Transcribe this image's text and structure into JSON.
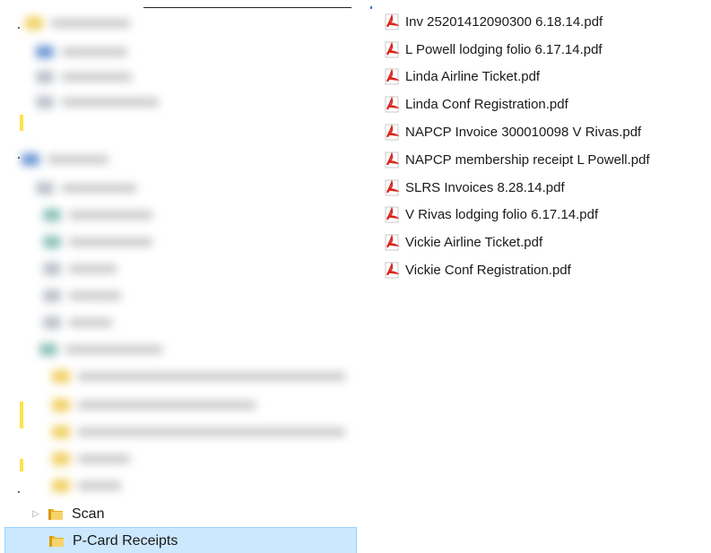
{
  "navigation_pane": {
    "tree": [
      {
        "label": "Scan",
        "expandable": true,
        "selected": false,
        "icon": "folder-icon"
      },
      {
        "label": "P-Card Receipts",
        "expandable": false,
        "selected": true,
        "icon": "folder-icon"
      }
    ]
  },
  "file_list": {
    "items": [
      {
        "name": "Inv 25201412090300 6.18.14.pdf",
        "icon": "pdf-icon"
      },
      {
        "name": "L Powell lodging folio 6.17.14.pdf",
        "icon": "pdf-icon"
      },
      {
        "name": "Linda Airline Ticket.pdf",
        "icon": "pdf-icon"
      },
      {
        "name": "Linda Conf Registration.pdf",
        "icon": "pdf-icon"
      },
      {
        "name": "NAPCP Invoice 300010098 V Rivas.pdf",
        "icon": "pdf-icon"
      },
      {
        "name": "NAPCP membership receipt L Powell.pdf",
        "icon": "pdf-icon"
      },
      {
        "name": "SLRS Invoices 8.28.14.pdf",
        "icon": "pdf-icon"
      },
      {
        "name": "V Rivas lodging folio 6.17.14.pdf",
        "icon": "pdf-icon"
      },
      {
        "name": "Vickie Airline Ticket.pdf",
        "icon": "pdf-icon"
      },
      {
        "name": "Vickie Conf Registration.pdf",
        "icon": "pdf-icon"
      }
    ]
  },
  "colors": {
    "selection_fill": "#cce8ff",
    "selection_border": "#99d1ff",
    "folder_yellow": "#f4c542",
    "pdf_red": "#d9251c"
  }
}
